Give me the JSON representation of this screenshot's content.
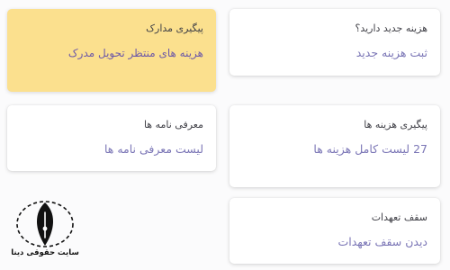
{
  "cards": {
    "new_expense": {
      "title": "هزینه جدید دارید؟",
      "link": "ثبت هزینه جدید"
    },
    "docs_tracking": {
      "title": "پیگیری مدارک",
      "link": "هزینه های منتظر تحویل مدرک"
    },
    "introduction_letters": {
      "title": "معرفی نامه ها",
      "link": "لیست معرفی نامه ها"
    },
    "expense_tracking": {
      "title": "پیگیری هزینه ها",
      "link": "27 لیست کامل هزینه ها"
    },
    "commitment_limit": {
      "title": "سقف تعهدات",
      "link": "دیدن سقف تعهدات"
    }
  },
  "watermark": {
    "caption": "سایت حقوقی دینا",
    "icon": "fountain-pen-nib-icon"
  },
  "colors": {
    "link": "#7b76b6",
    "highlight_card": "#fbe08e",
    "title_text": "#3f3f46",
    "page_background": "#fbfbfc"
  }
}
